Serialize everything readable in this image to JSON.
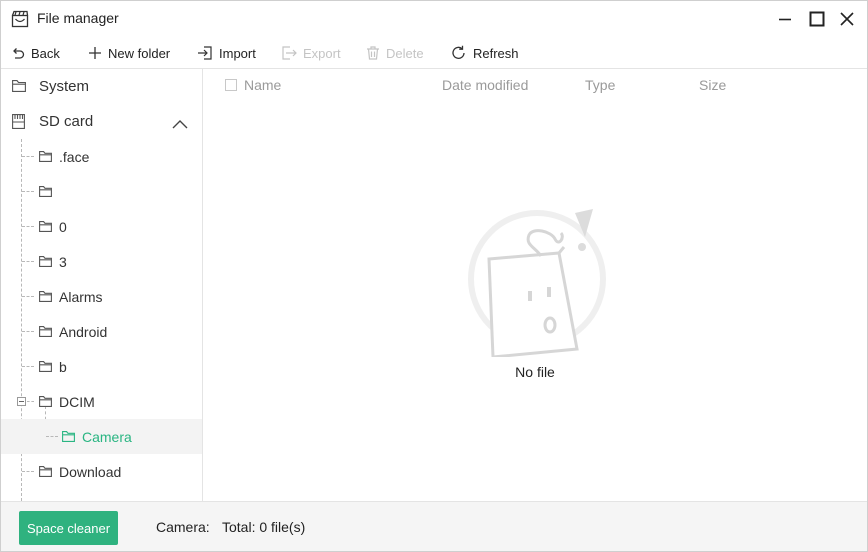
{
  "window": {
    "title": "File manager",
    "app_icon": "film-clapper-icon"
  },
  "toolbar": {
    "back": "Back",
    "new_folder": "New folder",
    "import": "Import",
    "export": "Export",
    "delete": "Delete",
    "refresh": "Refresh"
  },
  "sidebar": {
    "system": "System",
    "sd_card": "SD card",
    "folders": [
      {
        "label": ".face"
      },
      {
        "label": ""
      },
      {
        "label": "0"
      },
      {
        "label": "3"
      },
      {
        "label": "Alarms"
      },
      {
        "label": "Android"
      },
      {
        "label": "b"
      },
      {
        "label": "DCIM",
        "expanded": true
      },
      {
        "label": "Camera",
        "selected": true,
        "child_of": "DCIM"
      },
      {
        "label": "Download"
      }
    ]
  },
  "main": {
    "columns": [
      "Name",
      "Date modified",
      "Type",
      "Size"
    ],
    "empty_text": "No file"
  },
  "footer": {
    "space_cleaner": "Space cleaner",
    "current_dir": "Camera:",
    "total": "Total: 0 file(s)"
  },
  "colors": {
    "accent": "#2fb27f",
    "selected_text": "#29b582"
  }
}
